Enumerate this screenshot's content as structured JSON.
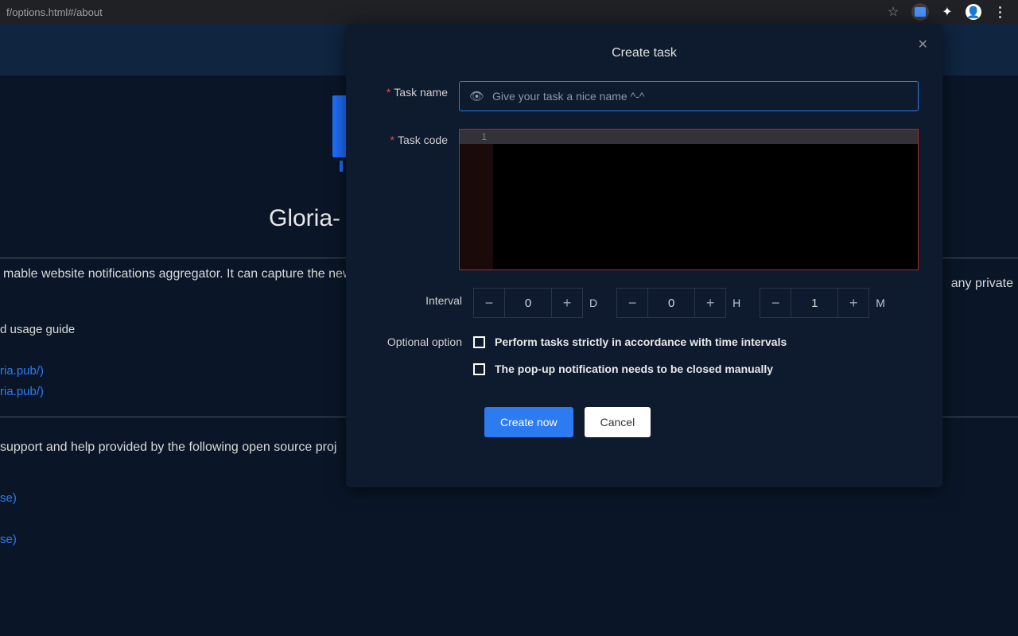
{
  "browser": {
    "url_fragment": "f/options.html#/about"
  },
  "background": {
    "title": "Gloria-",
    "description_left": "mable website notifications aggregator. It can capture the new",
    "description_right": "any private",
    "guide": "d usage guide",
    "link_a": "ria.pub/)",
    "link_b": "ria.pub/)",
    "support": "support and help provided by the following open source proj",
    "link_c": "se)",
    "link_d": "se)"
  },
  "modal": {
    "title": "Create task",
    "labels": {
      "task_name": "Task name",
      "task_code": "Task code",
      "interval": "Interval",
      "optional": "Optional option"
    },
    "task_name_placeholder": "Give your task a nice name ^-^",
    "code_gutter_first": "1",
    "interval": {
      "days": "0",
      "hours": "0",
      "minutes": "1",
      "unit_d": "D",
      "unit_h": "H",
      "unit_m": "M"
    },
    "options": {
      "strict": "Perform tasks strictly in accordance with time intervals",
      "manual_close": "The pop-up notification needs to be closed manually"
    },
    "buttons": {
      "create": "Create now",
      "cancel": "Cancel"
    }
  }
}
